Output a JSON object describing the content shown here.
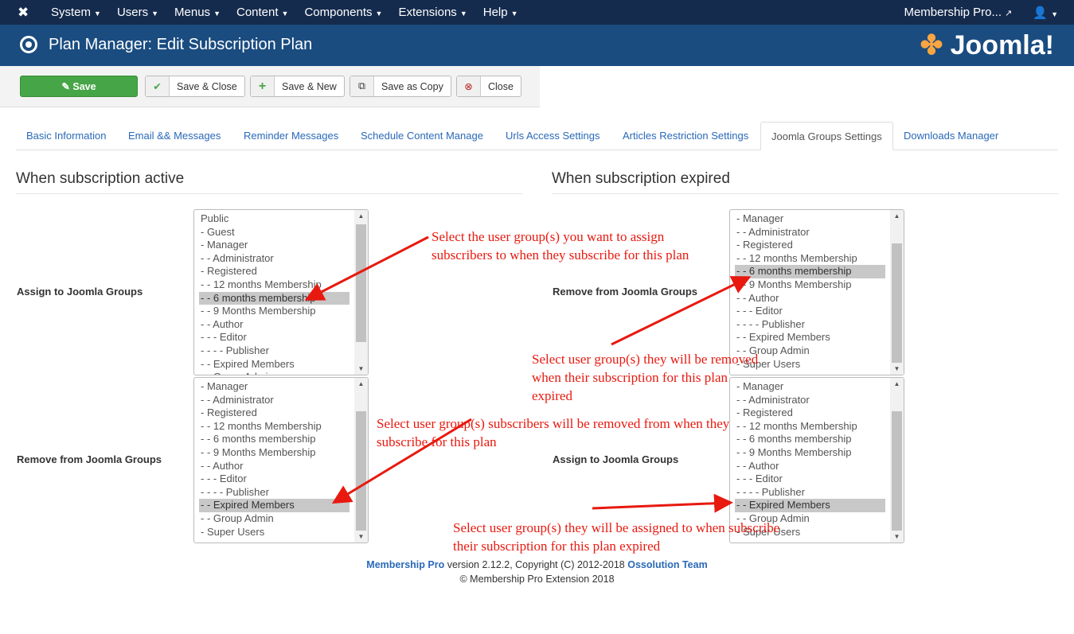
{
  "nav": {
    "items": [
      "System",
      "Users",
      "Menus",
      "Content",
      "Components",
      "Extensions",
      "Help"
    ],
    "user_menu": "Membership Pro...",
    "user_icon": "user-icon"
  },
  "header": {
    "title": "Plan Manager: Edit Subscription Plan",
    "logo": "Joomla!"
  },
  "toolbar": {
    "save": "Save",
    "save_close": "Save & Close",
    "save_new": "Save & New",
    "save_copy": "Save as Copy",
    "close": "Close"
  },
  "tabs": [
    "Basic Information",
    "Email && Messages",
    "Reminder Messages",
    "Schedule Content Manage",
    "Urls Access Settings",
    "Articles Restriction Settings",
    "Joomla Groups Settings",
    "Downloads Manager"
  ],
  "active_tab": "Joomla Groups Settings",
  "active": {
    "heading": "When subscription active",
    "assign_label": "Assign to Joomla Groups",
    "remove_label": "Remove from Joomla Groups",
    "assign_items": [
      "Public",
      "- Guest",
      "- Manager",
      "- - Administrator",
      "- Registered",
      "- - 12 months Membership",
      "- - 6 months membership",
      "- - 9 Months Membership",
      "- - Author",
      "- - - Editor",
      "- - - - Publisher",
      "- - Expired Members",
      "- - Group Admin"
    ],
    "assign_selected": "- - 6 months membership",
    "remove_items": [
      "- Manager",
      "- - Administrator",
      "- Registered",
      "- - 12 months Membership",
      "- - 6 months membership",
      "- - 9 Months Membership",
      "- - Author",
      "- - - Editor",
      "- - - - Publisher",
      "- - Expired Members",
      "- - Group Admin",
      "- Super Users"
    ],
    "remove_selected": "- - Expired Members"
  },
  "expired": {
    "heading": "When subscription expired",
    "remove_label": "Remove from Joomla Groups",
    "assign_label": "Assign to Joomla Groups",
    "remove_items": [
      "- Manager",
      "- - Administrator",
      "- Registered",
      "- - 12 months Membership",
      "- - 6 months membership",
      "- - 9 Months Membership",
      "- - Author",
      "- - - Editor",
      "- - - - Publisher",
      "- - Expired Members",
      "- - Group Admin",
      "- Super Users"
    ],
    "remove_selected": "- - 6 months membership",
    "assign_items": [
      "- Manager",
      "- - Administrator",
      "- Registered",
      "- - 12 months Membership",
      "- - 6 months membership",
      "- - 9 Months Membership",
      "- - Author",
      "- - - Editor",
      "- - - - Publisher",
      "- - Expired Members",
      "- - Group Admin",
      "- Super Users"
    ],
    "assign_selected": "- - Expired Members"
  },
  "notes": {
    "n1": "Select the user group(s) you want to assign subscribers to when they subscribe for this plan",
    "n2": "Select user group(s) subscribers will be removed from when they subscribe for this plan",
    "n3": "Select user group(s) they will be removed when their subscription for this plan expired",
    "n4": "Select user group(s) they will be assigned to when subscribe their subscription for this plan expired"
  },
  "footer": {
    "product": "Membership Pro",
    "version": " version 2.12.2, Copyright (C) 2012-2018 ",
    "team": "Ossolution Team",
    "line2": "© Membership Pro Extension 2018"
  },
  "colors": {
    "nav": "#152b4d",
    "header": "#1a4c80",
    "save": "#46a546",
    "link": "#2a69b8",
    "annotation": "#e8190f"
  }
}
